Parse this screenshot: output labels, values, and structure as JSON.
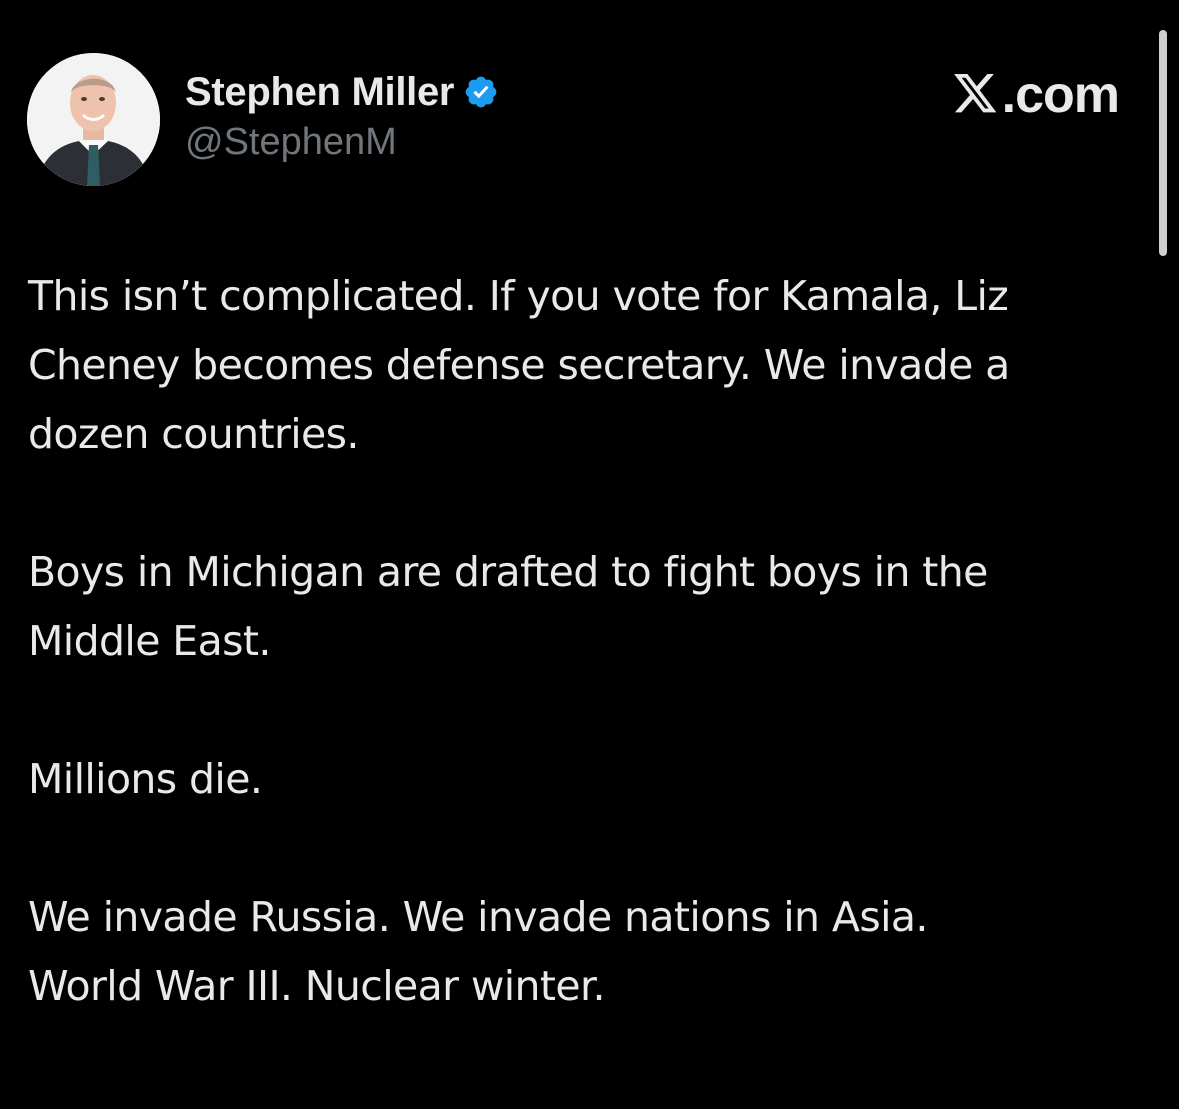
{
  "post": {
    "author": {
      "display_name": "Stephen Miller",
      "handle": "@StephenM",
      "verified": true,
      "avatar_icon": "profile-photo"
    },
    "brand": {
      "icon": "x-logo-icon",
      "text": ".com"
    },
    "paragraphs": [
      "This isn’t complicated. If you vote for Kamala, Liz\nCheney becomes defense secretary. We invade a\ndozen countries.",
      "Boys in Michigan are drafted to fight boys in the\nMiddle East.",
      "Millions die.",
      "We invade Russia. We invade nations in Asia.\nWorld War III. Nuclear winter."
    ]
  },
  "colors": {
    "background": "#000000",
    "text": "#e7e9ea",
    "handle": "#71767b",
    "verified_badge": "#1d9bf0"
  }
}
